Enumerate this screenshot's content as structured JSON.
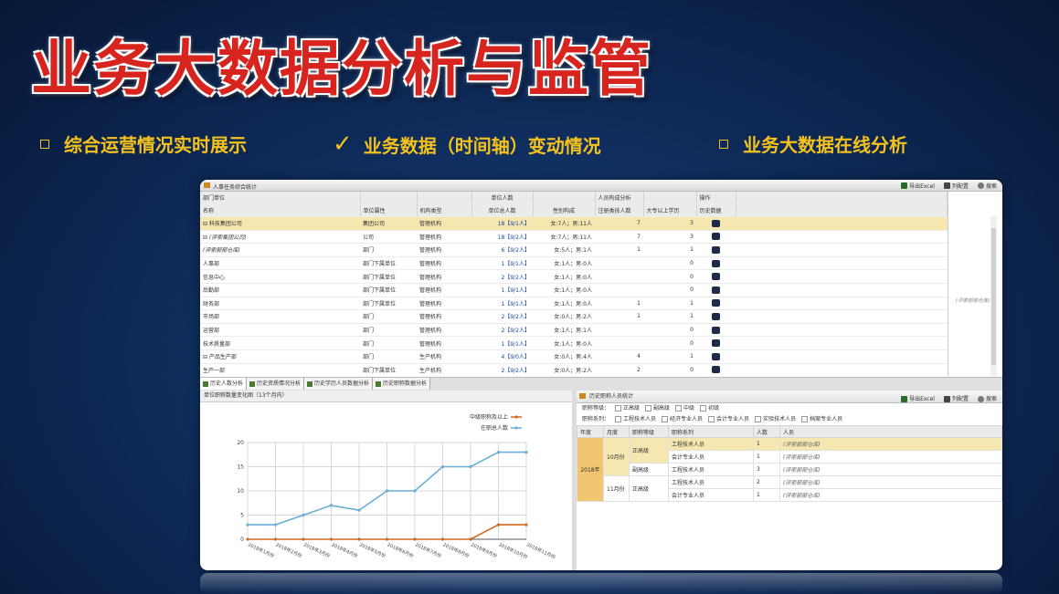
{
  "slide": {
    "title": "业务大数据分析与监管",
    "bullets": [
      {
        "text": "综合运营情况实时展示",
        "mark": "box"
      },
      {
        "text": "业务数据（时间轴）变动情况",
        "mark": "check"
      },
      {
        "text": "业务大数据在线分析",
        "mark": "box"
      }
    ],
    "check_glyph": "✓",
    "colors": {
      "title": "#d7241e",
      "bullet": "#f4c21e",
      "background": "#0f2c5c"
    }
  },
  "app": {
    "window_title": "人事任务综合统计",
    "toolbar": {
      "export": "导出Excel",
      "columns": "列配置",
      "search": "搜索"
    },
    "grid": {
      "group_headers": [
        "部门单位",
        "",
        "",
        "单位人数",
        "",
        "人员构成分析",
        "",
        "操作"
      ],
      "headers": [
        "名称",
        "单位属性",
        "机构类型",
        "单位总人数",
        "性别构成",
        "注册类技人数",
        "大专以上学历",
        "历史数据"
      ],
      "rows": [
        {
          "name": "⊟ 科技集团公司",
          "attr": "集团公司",
          "type": "管理机构",
          "count": "18【9/1人】",
          "gender": "女:7人；男:11人",
          "reg": "7",
          "edu": "3",
          "sel": true
        },
        {
          "name": "  ⊟ (评索集团公司)",
          "attr": "公司",
          "type": "管理机构",
          "count": "18【9/2人】",
          "gender": "女:7人；男:11人",
          "reg": "7",
          "edu": "3"
        },
        {
          "name": "    (评索部部仓库)",
          "attr": "部门",
          "type": "管理机构",
          "count": "6【9/2人】",
          "gender": "女:5人；男:1人",
          "reg": "1",
          "edu": "1"
        },
        {
          "name": "      人事部",
          "attr": "部门下属单位",
          "type": "管理机构",
          "count": "1【9/1人】",
          "gender": "女:1人；男:0人",
          "reg": "",
          "edu": "0"
        },
        {
          "name": "      信息中心",
          "attr": "部门下属单位",
          "type": "管理机构",
          "count": "2【9/2人】",
          "gender": "女:1人；男:0人",
          "reg": "",
          "edu": "0"
        },
        {
          "name": "      后勤部",
          "attr": "部门下属单位",
          "type": "管理机构",
          "count": "1【9/1人】",
          "gender": "女:1人；男:0人",
          "reg": "",
          "edu": "0"
        },
        {
          "name": "      财务部",
          "attr": "部门下属单位",
          "type": "管理机构",
          "count": "1【9/1人】",
          "gender": "女:1人；男:0人",
          "reg": "1",
          "edu": "1"
        },
        {
          "name": "    市场部",
          "attr": "部门",
          "type": "管理机构",
          "count": "2【9/2人】",
          "gender": "女:0人；男:2人",
          "reg": "1",
          "edu": "1"
        },
        {
          "name": "    运营部",
          "attr": "部门",
          "type": "管理机构",
          "count": "2【9/2人】",
          "gender": "女:1人；男:1人",
          "reg": "",
          "edu": "0"
        },
        {
          "name": "    技术质量部",
          "attr": "部门",
          "type": "管理机构",
          "count": "1【9/1人】",
          "gender": "女:1人；男:0人",
          "reg": "",
          "edu": "0"
        },
        {
          "name": "  ⊟ 产品生产部",
          "attr": "部门",
          "type": "生产机构",
          "count": "4【9/0人】",
          "gender": "女:0人；男:4人",
          "reg": "4",
          "edu": "1"
        },
        {
          "name": "      生产一部",
          "attr": "部门下属单位",
          "type": "生产机构",
          "count": "2【9/2人】",
          "gender": "女:0人；男:2人",
          "reg": "2",
          "edu": "0"
        }
      ],
      "right_placeholder": "(评索部部仓库)"
    },
    "tabs": [
      "历史人数分析",
      "历史资质情况分析",
      "历史学历人员数据分析",
      "历史职称数据分析"
    ],
    "left_panel_title": "单位职称数量变化图（13个月内）",
    "right_panel": {
      "title": "历史职称人员统计",
      "filter1_label": "职称等级：",
      "filter1": [
        "正高级",
        "副高级",
        "中级",
        "初级"
      ],
      "filter2_label": "职称系列：",
      "filter2": [
        "工程技术人员",
        "经济专业人员",
        "会计专业人员",
        "实验技术人员",
        "档案专业人员"
      ],
      "headers": [
        "年度",
        "月度",
        "职称等级",
        "职称系列",
        "人数",
        "人员"
      ],
      "year": "2018年",
      "rows": [
        {
          "month": "10月份",
          "level": "正高级",
          "series": "工程技术人员",
          "n": "1",
          "people": "(评索部部仓库)",
          "sel": true
        },
        {
          "month": "",
          "level": "",
          "series": "会计专业人员",
          "n": "1",
          "people": "(评索部部仓库)"
        },
        {
          "month": "",
          "level": "副高级",
          "series": "工程技术人员",
          "n": "3",
          "people": "(评索部部仓库)"
        },
        {
          "month": "11月份",
          "level": "正高级",
          "series": "工程技术人员",
          "n": "2",
          "people": "(评索部部仓库)"
        },
        {
          "month": "",
          "level": "",
          "series": "会计专业人员",
          "n": "1",
          "people": "(评索部部仓库)"
        }
      ]
    }
  },
  "chart_data": {
    "type": "line",
    "title": "",
    "x": [
      "2018年1月份",
      "2018年2月份",
      "2018年3月份",
      "2018年4月份",
      "2018年5月份",
      "2018年6月份",
      "2018年7月份",
      "2018年8月份",
      "2018年9月份",
      "2018年10月份",
      "2018年11月份"
    ],
    "ylim": [
      0,
      20
    ],
    "yticks": [
      0,
      5,
      10,
      15,
      20
    ],
    "legend_position": "top-right",
    "grid": true,
    "series": [
      {
        "name": "中级职称及以上",
        "color": "#d2691e",
        "values": [
          0,
          0,
          0,
          0,
          0,
          0,
          0,
          0,
          0,
          3,
          3
        ]
      },
      {
        "name": "在职总人数",
        "color": "#6aaed6",
        "values": [
          3,
          3,
          5,
          7,
          6,
          10,
          10,
          15,
          15,
          18,
          18
        ]
      }
    ]
  }
}
